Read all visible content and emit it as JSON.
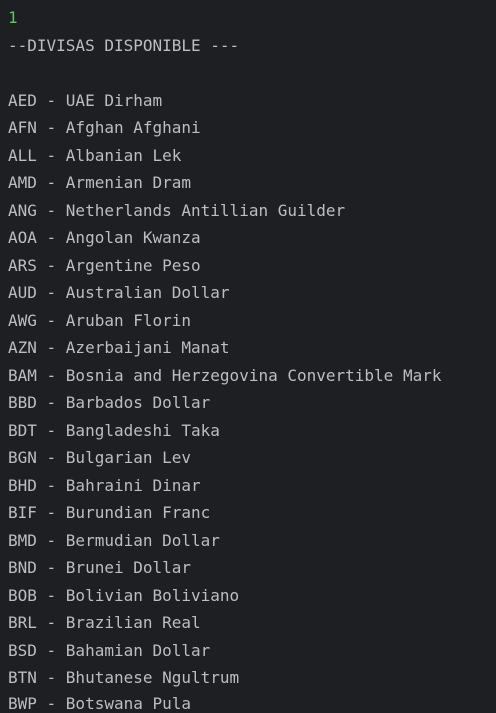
{
  "console": {
    "input_echo": "1",
    "header": "--DIVISAS DISPONIBLE ---",
    "currencies": [
      "AED - UAE Dirham",
      "AFN - Afghan Afghani",
      "ALL - Albanian Lek",
      "AMD - Armenian Dram",
      "ANG - Netherlands Antillian Guilder",
      "AOA - Angolan Kwanza",
      "ARS - Argentine Peso",
      "AUD - Australian Dollar",
      "AWG - Aruban Florin",
      "AZN - Azerbaijani Manat",
      "BAM - Bosnia and Herzegovina Convertible Mark",
      "BBD - Barbados Dollar",
      "BDT - Bangladeshi Taka",
      "BGN - Bulgarian Lev",
      "BHD - Bahraini Dinar",
      "BIF - Burundian Franc",
      "BMD - Bermudian Dollar",
      "BND - Brunei Dollar",
      "BOB - Bolivian Boliviano",
      "BRL - Brazilian Real",
      "BSD - Bahamian Dollar",
      "BTN - Bhutanese Ngultrum",
      "BWP - Botswana Pula"
    ]
  },
  "colors": {
    "background": "#1e1f22",
    "text": "#bcbec4",
    "input_echo": "#62c462"
  }
}
